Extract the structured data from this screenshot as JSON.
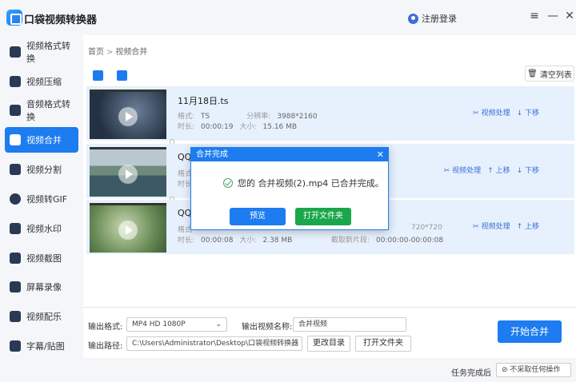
{
  "app": {
    "title": "口袋视频转换器",
    "login": "注册登录"
  },
  "window": {
    "menu_icon": "≡",
    "min_icon": "—",
    "close_icon": "✕"
  },
  "sidebar": {
    "items": [
      {
        "label": "视频格式转换"
      },
      {
        "label": "视频压缩"
      },
      {
        "label": "音频格式转换"
      },
      {
        "label": "视频合并",
        "active": true
      },
      {
        "label": "视频分割"
      },
      {
        "label": "视频转GIF"
      },
      {
        "label": "视频水印"
      },
      {
        "label": "视频截图"
      },
      {
        "label": "屏幕录像"
      },
      {
        "label": "视频配乐"
      },
      {
        "label": "字幕/贴图"
      }
    ]
  },
  "breadcrumb": {
    "home": "首页",
    "sep": ">",
    "current": "视频合并"
  },
  "toolbar": {
    "clear_label": "清空列表"
  },
  "files": [
    {
      "name": "11月18日.ts",
      "format_label": "格式:",
      "format": "TS",
      "res_label": "分辨率:",
      "res": "3988*2160",
      "dur_label": "时长:",
      "dur": "00:00:19",
      "size_label": "大小:",
      "size": "15.16 MB",
      "actions": [
        "视频处理",
        "↓ 下移"
      ]
    },
    {
      "name": "QQ",
      "format_label": "格式",
      "dur_label": "时长",
      "actions": [
        "视频处理",
        "↑ 上移",
        "↓ 下移"
      ]
    },
    {
      "name": "QQ",
      "format_label": "格式",
      "dur_label": "时长:",
      "dur": "00:00:08",
      "size_label": "大小:",
      "size": "2.38 MB",
      "res": "720*720",
      "cut_label": "截取新片段:",
      "cut": "00:00:00-00:00:08",
      "actions": [
        "视频处理",
        "↑ 上移"
      ]
    }
  ],
  "dialog": {
    "title": "合并完成",
    "close": "✕",
    "message": "您的 合并视频(2).mp4 已合并完成。",
    "preview": "预览",
    "open_folder": "打开文件夹"
  },
  "output": {
    "format_label": "输出格式:",
    "format_value": "MP4  HD 1080P",
    "name_label": "输出视频名称:",
    "name_value": "合并视频",
    "path_label": "输出路径:",
    "path_value": "C:\\Users\\Administrator\\Desktop\\口袋视频转换器",
    "change_dir": "更改目录",
    "open_folder": "打开文件夹",
    "start": "开始合并"
  },
  "footer": {
    "after_label": "任务完成后",
    "after_value": "不采取任何操作"
  },
  "colors": {
    "accent": "#1c7cf0",
    "green": "#1aa64a"
  }
}
